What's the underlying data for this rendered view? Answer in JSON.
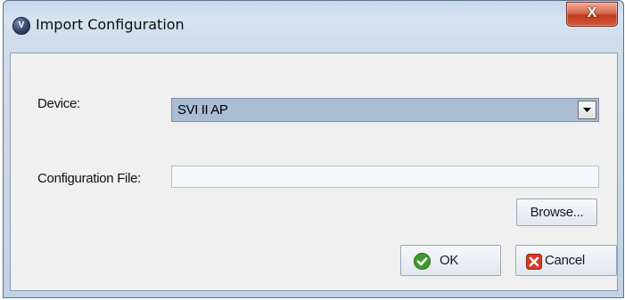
{
  "window": {
    "title": "Import Configuration",
    "app_icon_glyph": "V",
    "close_glyph": "X"
  },
  "form": {
    "device_label": "Device:",
    "device_value": "SVI II AP",
    "config_file_label": "Configuration File:",
    "config_file_value": "",
    "browse_label": "Browse..."
  },
  "buttons": {
    "ok_label": "OK",
    "cancel_label": "Cancel"
  },
  "icons": {
    "app": "v-logo-icon",
    "close": "close-icon",
    "dropdown": "dropdown-arrow-icon",
    "ok": "check-icon",
    "cancel": "x-icon"
  },
  "colors": {
    "selected_bg": "#abbdd5",
    "close_red": "#c0391d",
    "ok_green": "#3f9a2d",
    "cancel_red": "#d43b26"
  }
}
